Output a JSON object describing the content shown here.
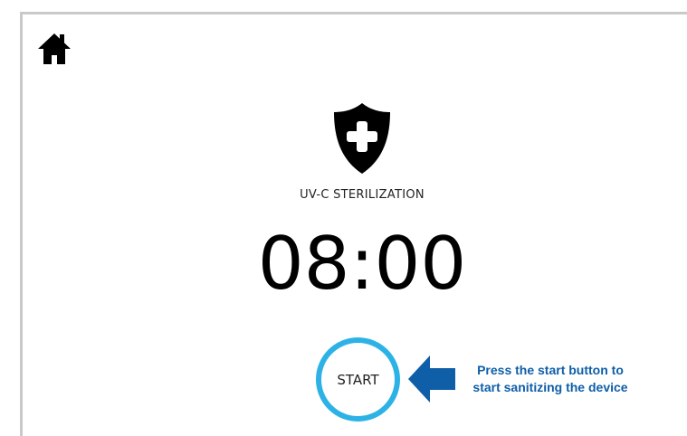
{
  "header": {
    "home_icon": "home-icon"
  },
  "mode": {
    "icon": "shield-plus-icon",
    "title": "UV-C STERILIZATION"
  },
  "timer": {
    "display": "08:00"
  },
  "controls": {
    "start_label": "START"
  },
  "hint": {
    "arrow_icon": "left-arrow-icon",
    "line1": "Press the start button to",
    "line2": "start sanitizing the device"
  },
  "colors": {
    "accent_ring": "#2db2e6",
    "hint_blue": "#0e5ea8",
    "frame_border": "#c9c9c9"
  }
}
